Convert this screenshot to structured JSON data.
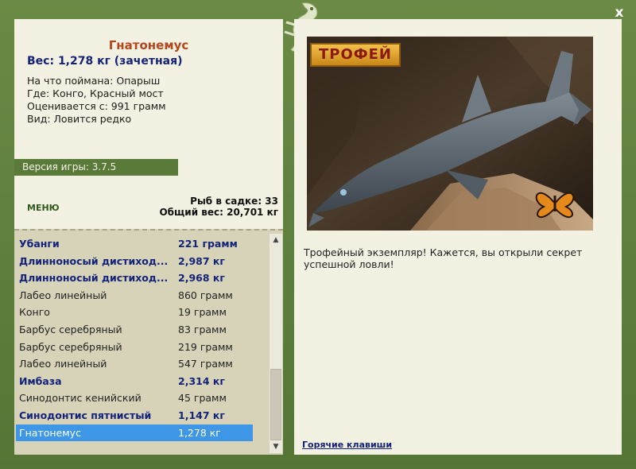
{
  "close_label": "x",
  "detail": {
    "title": "Гнатонемус",
    "weight_line": "Вес: 1,278 кг (зачетная)",
    "caught_with": "На что поймана: Опарыш",
    "location": "Где: Конго, Красный мост",
    "valued_from": "Оценивается с: 991 грамм",
    "kind": "Вид: Ловится редко"
  },
  "version": "Версия игры: 3.7.5",
  "menu_label": "МЕНЮ",
  "cage": {
    "count": "Рыб в садке: 33",
    "total_weight": "Общий вес: 20,701 кг"
  },
  "catch_list": [
    {
      "name": "Убанги",
      "weight": "221 грамм",
      "bold": true
    },
    {
      "name": "Длинноносый дистиход...",
      "weight": "2,987 кг",
      "bold": true
    },
    {
      "name": "Длинноносый дистиход...",
      "weight": "2,968 кг",
      "bold": true
    },
    {
      "name": "Лабео линейный",
      "weight": "860 грамм",
      "bold": false
    },
    {
      "name": "Конго",
      "weight": "19 грамм",
      "bold": false
    },
    {
      "name": "Барбус серебряный",
      "weight": "83 грамм",
      "bold": false
    },
    {
      "name": "Барбус серебряный",
      "weight": "219 грамм",
      "bold": false
    },
    {
      "name": "Лабео линейный",
      "weight": "547 грамм",
      "bold": false
    },
    {
      "name": "Имбаза",
      "weight": "2,314 кг",
      "bold": true
    },
    {
      "name": "Синодонтис кенийский",
      "weight": "45 грамм",
      "bold": false
    },
    {
      "name": "Синодонтис пятнистый",
      "weight": "1,147 кг",
      "bold": true
    },
    {
      "name": "Гнатонемус",
      "weight": "1,278 кг",
      "bold": false,
      "selected": true
    }
  ],
  "trophy": {
    "badge": "ТРОФЕЙ",
    "text": "Трофейный экземпляр! Кажется, вы открыли секрет успешной ловли!"
  },
  "hotkeys_label": "Горячие клавиши",
  "colors": {
    "frame": "#5b7a3c",
    "panel": "#f3f1e2",
    "list_bg": "#d6d3b9",
    "selection": "#3d96e6",
    "title": "#b5451b",
    "accent_text": "#14237a"
  }
}
